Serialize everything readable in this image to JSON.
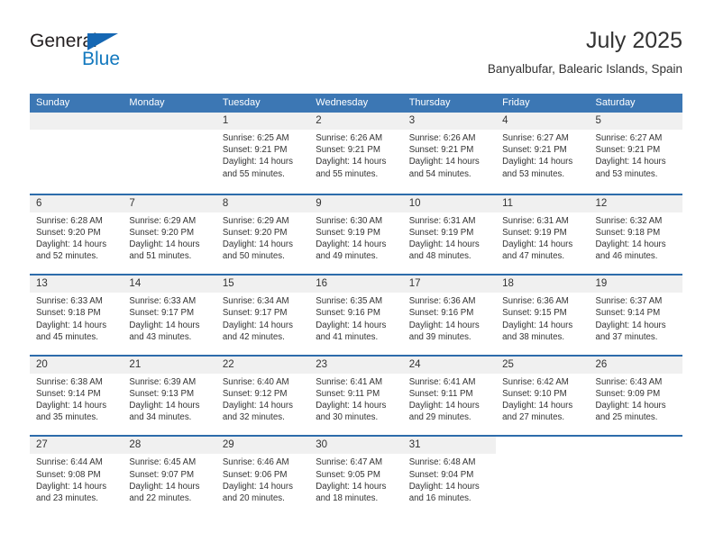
{
  "logo": {
    "word_one": "General",
    "word_two": "Blue",
    "triangle_color": "#1567b3",
    "blue_text_color": "#1278be",
    "dark_text_color": "#231f20"
  },
  "header": {
    "title": "July 2025",
    "subtitle": "Banyalbufar, Balearic Islands, Spain"
  },
  "theme": {
    "header_bar_color": "#3c77b4",
    "row_divider_color": "#2d6cab",
    "day_band_color": "#f0f0f0",
    "text_color": "#333333"
  },
  "weekdays": [
    "Sunday",
    "Monday",
    "Tuesday",
    "Wednesday",
    "Thursday",
    "Friday",
    "Saturday"
  ],
  "weeks": [
    {
      "band_cells": 7,
      "days": [
        {
          "num": "",
          "empty": true,
          "sunrise": "",
          "sunset": "",
          "daylight_line1": "",
          "daylight_line2": ""
        },
        {
          "num": "",
          "empty": true,
          "sunrise": "",
          "sunset": "",
          "daylight_line1": "",
          "daylight_line2": ""
        },
        {
          "num": "1",
          "empty": false,
          "sunrise": "Sunrise: 6:25 AM",
          "sunset": "Sunset: 9:21 PM",
          "daylight_line1": "Daylight: 14 hours",
          "daylight_line2": "and 55 minutes."
        },
        {
          "num": "2",
          "empty": false,
          "sunrise": "Sunrise: 6:26 AM",
          "sunset": "Sunset: 9:21 PM",
          "daylight_line1": "Daylight: 14 hours",
          "daylight_line2": "and 55 minutes."
        },
        {
          "num": "3",
          "empty": false,
          "sunrise": "Sunrise: 6:26 AM",
          "sunset": "Sunset: 9:21 PM",
          "daylight_line1": "Daylight: 14 hours",
          "daylight_line2": "and 54 minutes."
        },
        {
          "num": "4",
          "empty": false,
          "sunrise": "Sunrise: 6:27 AM",
          "sunset": "Sunset: 9:21 PM",
          "daylight_line1": "Daylight: 14 hours",
          "daylight_line2": "and 53 minutes."
        },
        {
          "num": "5",
          "empty": false,
          "sunrise": "Sunrise: 6:27 AM",
          "sunset": "Sunset: 9:21 PM",
          "daylight_line1": "Daylight: 14 hours",
          "daylight_line2": "and 53 minutes."
        }
      ]
    },
    {
      "band_cells": 7,
      "days": [
        {
          "num": "6",
          "empty": false,
          "sunrise": "Sunrise: 6:28 AM",
          "sunset": "Sunset: 9:20 PM",
          "daylight_line1": "Daylight: 14 hours",
          "daylight_line2": "and 52 minutes."
        },
        {
          "num": "7",
          "empty": false,
          "sunrise": "Sunrise: 6:29 AM",
          "sunset": "Sunset: 9:20 PM",
          "daylight_line1": "Daylight: 14 hours",
          "daylight_line2": "and 51 minutes."
        },
        {
          "num": "8",
          "empty": false,
          "sunrise": "Sunrise: 6:29 AM",
          "sunset": "Sunset: 9:20 PM",
          "daylight_line1": "Daylight: 14 hours",
          "daylight_line2": "and 50 minutes."
        },
        {
          "num": "9",
          "empty": false,
          "sunrise": "Sunrise: 6:30 AM",
          "sunset": "Sunset: 9:19 PM",
          "daylight_line1": "Daylight: 14 hours",
          "daylight_line2": "and 49 minutes."
        },
        {
          "num": "10",
          "empty": false,
          "sunrise": "Sunrise: 6:31 AM",
          "sunset": "Sunset: 9:19 PM",
          "daylight_line1": "Daylight: 14 hours",
          "daylight_line2": "and 48 minutes."
        },
        {
          "num": "11",
          "empty": false,
          "sunrise": "Sunrise: 6:31 AM",
          "sunset": "Sunset: 9:19 PM",
          "daylight_line1": "Daylight: 14 hours",
          "daylight_line2": "and 47 minutes."
        },
        {
          "num": "12",
          "empty": false,
          "sunrise": "Sunrise: 6:32 AM",
          "sunset": "Sunset: 9:18 PM",
          "daylight_line1": "Daylight: 14 hours",
          "daylight_line2": "and 46 minutes."
        }
      ]
    },
    {
      "band_cells": 7,
      "days": [
        {
          "num": "13",
          "empty": false,
          "sunrise": "Sunrise: 6:33 AM",
          "sunset": "Sunset: 9:18 PM",
          "daylight_line1": "Daylight: 14 hours",
          "daylight_line2": "and 45 minutes."
        },
        {
          "num": "14",
          "empty": false,
          "sunrise": "Sunrise: 6:33 AM",
          "sunset": "Sunset: 9:17 PM",
          "daylight_line1": "Daylight: 14 hours",
          "daylight_line2": "and 43 minutes."
        },
        {
          "num": "15",
          "empty": false,
          "sunrise": "Sunrise: 6:34 AM",
          "sunset": "Sunset: 9:17 PM",
          "daylight_line1": "Daylight: 14 hours",
          "daylight_line2": "and 42 minutes."
        },
        {
          "num": "16",
          "empty": false,
          "sunrise": "Sunrise: 6:35 AM",
          "sunset": "Sunset: 9:16 PM",
          "daylight_line1": "Daylight: 14 hours",
          "daylight_line2": "and 41 minutes."
        },
        {
          "num": "17",
          "empty": false,
          "sunrise": "Sunrise: 6:36 AM",
          "sunset": "Sunset: 9:16 PM",
          "daylight_line1": "Daylight: 14 hours",
          "daylight_line2": "and 39 minutes."
        },
        {
          "num": "18",
          "empty": false,
          "sunrise": "Sunrise: 6:36 AM",
          "sunset": "Sunset: 9:15 PM",
          "daylight_line1": "Daylight: 14 hours",
          "daylight_line2": "and 38 minutes."
        },
        {
          "num": "19",
          "empty": false,
          "sunrise": "Sunrise: 6:37 AM",
          "sunset": "Sunset: 9:14 PM",
          "daylight_line1": "Daylight: 14 hours",
          "daylight_line2": "and 37 minutes."
        }
      ]
    },
    {
      "band_cells": 7,
      "days": [
        {
          "num": "20",
          "empty": false,
          "sunrise": "Sunrise: 6:38 AM",
          "sunset": "Sunset: 9:14 PM",
          "daylight_line1": "Daylight: 14 hours",
          "daylight_line2": "and 35 minutes."
        },
        {
          "num": "21",
          "empty": false,
          "sunrise": "Sunrise: 6:39 AM",
          "sunset": "Sunset: 9:13 PM",
          "daylight_line1": "Daylight: 14 hours",
          "daylight_line2": "and 34 minutes."
        },
        {
          "num": "22",
          "empty": false,
          "sunrise": "Sunrise: 6:40 AM",
          "sunset": "Sunset: 9:12 PM",
          "daylight_line1": "Daylight: 14 hours",
          "daylight_line2": "and 32 minutes."
        },
        {
          "num": "23",
          "empty": false,
          "sunrise": "Sunrise: 6:41 AM",
          "sunset": "Sunset: 9:11 PM",
          "daylight_line1": "Daylight: 14 hours",
          "daylight_line2": "and 30 minutes."
        },
        {
          "num": "24",
          "empty": false,
          "sunrise": "Sunrise: 6:41 AM",
          "sunset": "Sunset: 9:11 PM",
          "daylight_line1": "Daylight: 14 hours",
          "daylight_line2": "and 29 minutes."
        },
        {
          "num": "25",
          "empty": false,
          "sunrise": "Sunrise: 6:42 AM",
          "sunset": "Sunset: 9:10 PM",
          "daylight_line1": "Daylight: 14 hours",
          "daylight_line2": "and 27 minutes."
        },
        {
          "num": "26",
          "empty": false,
          "sunrise": "Sunrise: 6:43 AM",
          "sunset": "Sunset: 9:09 PM",
          "daylight_line1": "Daylight: 14 hours",
          "daylight_line2": "and 25 minutes."
        }
      ]
    },
    {
      "band_cells": 5,
      "days": [
        {
          "num": "27",
          "empty": false,
          "sunrise": "Sunrise: 6:44 AM",
          "sunset": "Sunset: 9:08 PM",
          "daylight_line1": "Daylight: 14 hours",
          "daylight_line2": "and 23 minutes."
        },
        {
          "num": "28",
          "empty": false,
          "sunrise": "Sunrise: 6:45 AM",
          "sunset": "Sunset: 9:07 PM",
          "daylight_line1": "Daylight: 14 hours",
          "daylight_line2": "and 22 minutes."
        },
        {
          "num": "29",
          "empty": false,
          "sunrise": "Sunrise: 6:46 AM",
          "sunset": "Sunset: 9:06 PM",
          "daylight_line1": "Daylight: 14 hours",
          "daylight_line2": "and 20 minutes."
        },
        {
          "num": "30",
          "empty": false,
          "sunrise": "Sunrise: 6:47 AM",
          "sunset": "Sunset: 9:05 PM",
          "daylight_line1": "Daylight: 14 hours",
          "daylight_line2": "and 18 minutes."
        },
        {
          "num": "31",
          "empty": false,
          "sunrise": "Sunrise: 6:48 AM",
          "sunset": "Sunset: 9:04 PM",
          "daylight_line1": "Daylight: 14 hours",
          "daylight_line2": "and 16 minutes."
        },
        {
          "num": "",
          "empty": true,
          "sunrise": "",
          "sunset": "",
          "daylight_line1": "",
          "daylight_line2": ""
        },
        {
          "num": "",
          "empty": true,
          "sunrise": "",
          "sunset": "",
          "daylight_line1": "",
          "daylight_line2": ""
        }
      ]
    }
  ]
}
